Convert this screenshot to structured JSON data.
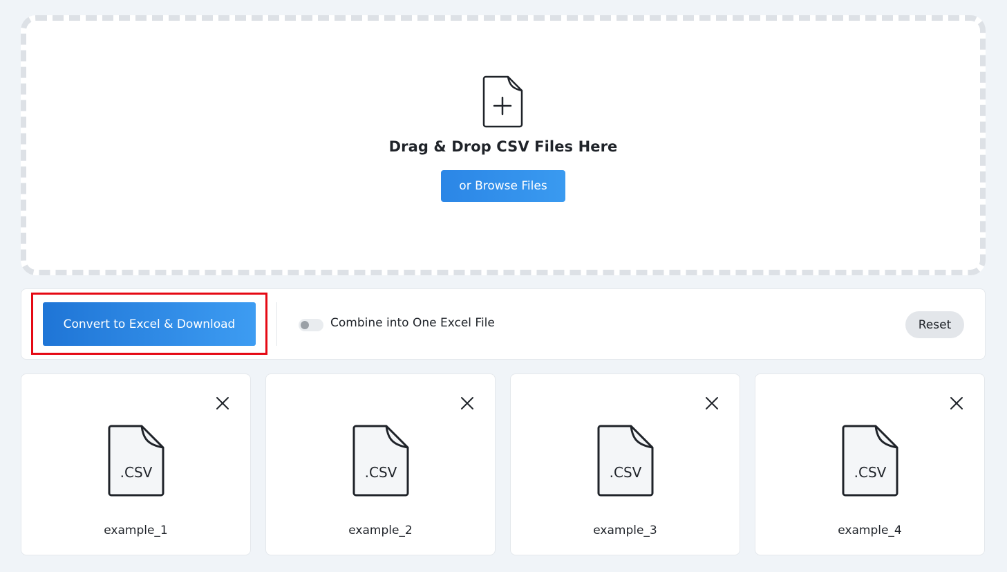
{
  "dropzone": {
    "title": "Drag & Drop CSV Files Here",
    "browse_label": "or Browse Files",
    "icon": "file-plus-icon"
  },
  "toolbar": {
    "convert_label": "Convert to Excel & Download",
    "combine_label": "Combine into One Excel File",
    "combine_enabled": false,
    "reset_label": "Reset"
  },
  "files": [
    {
      "name": "example_1",
      "ext": ".CSV"
    },
    {
      "name": "example_2",
      "ext": ".CSV"
    },
    {
      "name": "example_3",
      "ext": ".CSV"
    },
    {
      "name": "example_4",
      "ext": ".CSV"
    }
  ],
  "colors": {
    "accent": "#2b86e6",
    "highlight": "#e50914",
    "background": "#f0f4f8"
  }
}
